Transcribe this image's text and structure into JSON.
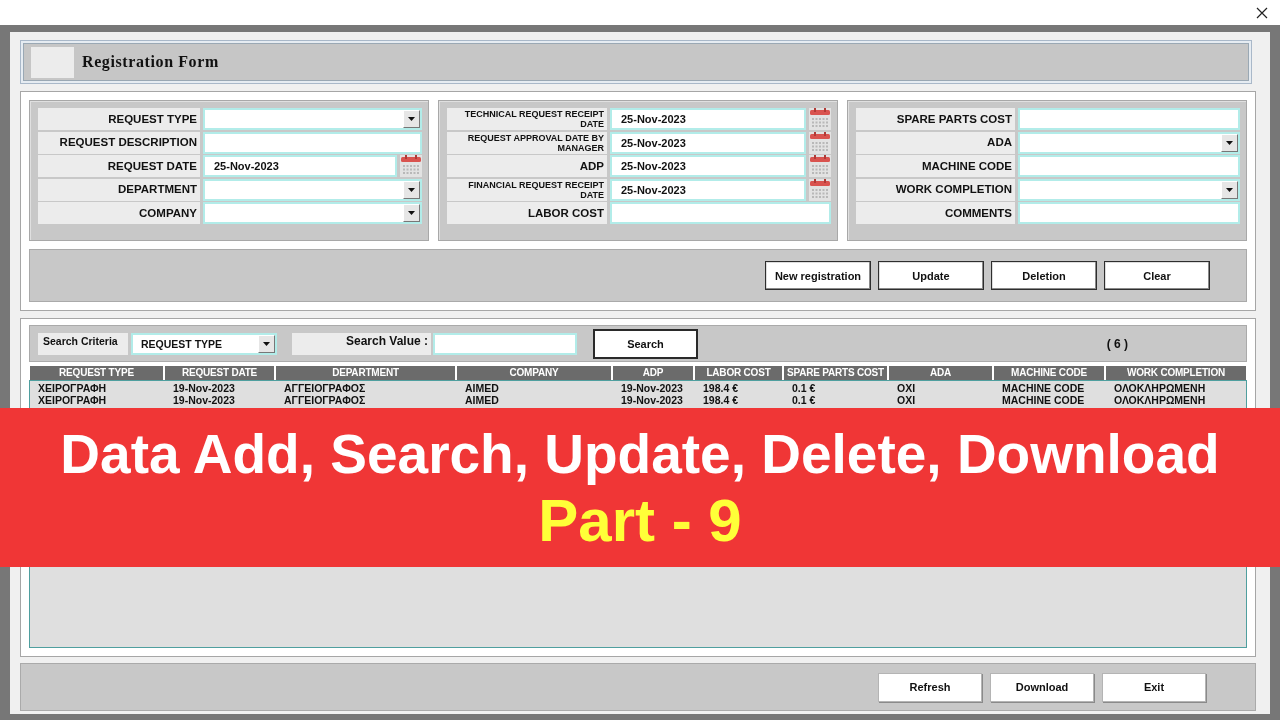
{
  "header": {
    "title": "Registration Form"
  },
  "form": {
    "panels": [
      {
        "fields": [
          {
            "label": "REQUEST TYPE",
            "kind": "dropdown"
          },
          {
            "label": "REQUEST DESCRIPTION",
            "kind": "text"
          },
          {
            "label": "REQUEST DATE",
            "kind": "date",
            "value": "25-Nov-2023"
          },
          {
            "label": "DEPARTMENT",
            "kind": "dropdown"
          },
          {
            "label": "COMPANY",
            "kind": "dropdown"
          }
        ]
      },
      {
        "fields": [
          {
            "label": "TECHNICAL REQUEST RECEIPT DATE",
            "kind": "date",
            "value": "25-Nov-2023"
          },
          {
            "label": "REQUEST APPROVAL DATE BY MANAGER",
            "kind": "date",
            "value": "25-Nov-2023"
          },
          {
            "label": "ADP",
            "kind": "date",
            "value": "25-Nov-2023"
          },
          {
            "label": "FINANCIAL REQUEST RECEIPT DATE",
            "kind": "date",
            "value": "25-Nov-2023"
          },
          {
            "label": "LABOR COST",
            "kind": "text"
          }
        ]
      },
      {
        "fields": [
          {
            "label": "SPARE PARTS COST",
            "kind": "text"
          },
          {
            "label": "ADA",
            "kind": "dropdown"
          },
          {
            "label": "MACHINE CODE",
            "kind": "text"
          },
          {
            "label": "WORK COMPLETION",
            "kind": "dropdown"
          },
          {
            "label": "COMMENTS",
            "kind": "text"
          }
        ]
      }
    ],
    "buttons": [
      "New registration",
      "Update",
      "Deletion",
      "Clear"
    ]
  },
  "search": {
    "criteria_label": "Search Criteria",
    "criteria": "REQUEST TYPE",
    "value_label": "Search Value :",
    "button": "Search",
    "count": "( 6 )"
  },
  "table": {
    "columns": [
      "REQUEST TYPE",
      "REQUEST DATE",
      "DEPARTMENT",
      "COMPANY",
      "ADP",
      "LABOR COST",
      "SPARE PARTS COST",
      "ADA",
      "MACHINE CODE",
      "WORK COMPLETION"
    ],
    "rows": [
      [
        "ΧΕΙΡΟΓΡΑΦΗ",
        "19-Nov-2023",
        "ΑΓΓΕΙΟΓΡΑΦΟΣ",
        "AIMED",
        "19-Nov-2023",
        "198.4 €",
        "0.1 €",
        "ΟΧΙ",
        "MACHINE CODE",
        "ΟΛΟΚΛΗΡΩΜΕΝΗ"
      ],
      [
        "ΧΕΙΡΟΓΡΑΦΗ",
        "19-Nov-2023",
        "ΑΓΓΕΙΟΓΡΑΦΟΣ",
        "AIMED",
        "19-Nov-2023",
        "198.4 €",
        "0.1 €",
        "ΟΧΙ",
        "MACHINE CODE",
        "ΟΛΟΚΛΗΡΩΜΕΝΗ"
      ]
    ]
  },
  "banner": {
    "title": "Data Add, Search, Update, Delete, Download",
    "subtitle": "Part - 9"
  },
  "footer": {
    "buttons": [
      "Refresh",
      "Download",
      "Exit"
    ]
  }
}
